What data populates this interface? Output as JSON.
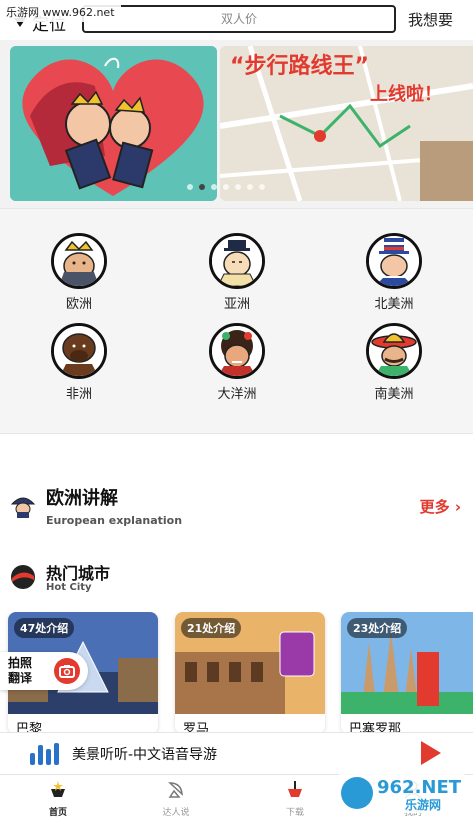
{
  "watermark_top": "乐游网 www.962.net",
  "header": {
    "location_label": "定位",
    "search_placeholder": "双人价",
    "want_label": "我想要"
  },
  "banner": {
    "slide2_title": "“步行路线王”",
    "slide2_sub": "上线啦！",
    "active_dot": 1,
    "dot_count": 7
  },
  "continents": [
    {
      "label": "欧洲"
    },
    {
      "label": "亚洲"
    },
    {
      "label": "北美洲"
    },
    {
      "label": "非洲"
    },
    {
      "label": "大洋洲"
    },
    {
      "label": "南美洲"
    }
  ],
  "europe_section": {
    "title": "欧洲讲解",
    "subtitle": "European explanation",
    "more_label": "更多"
  },
  "hot_section": {
    "title": "热门城市",
    "subtitle": "Hot City"
  },
  "cities": [
    {
      "badge": "47处介绍",
      "name": "巴黎"
    },
    {
      "badge": "21处介绍",
      "name": "罗马"
    },
    {
      "badge": "23处介绍",
      "name": "巴塞罗那"
    }
  ],
  "translate_button": {
    "line1": "拍照",
    "line2": "翻译"
  },
  "audio_bar": {
    "text": "美景听听-中文语音导游"
  },
  "tabs": [
    {
      "label": "首页"
    },
    {
      "label": "达人说"
    },
    {
      "label": "下载"
    },
    {
      "label": "我的"
    }
  ],
  "watermark_bottom": "962.NET 乐游网",
  "colors": {
    "accent_red": "#e23a2e",
    "audio_blue": "#2a72c9"
  }
}
